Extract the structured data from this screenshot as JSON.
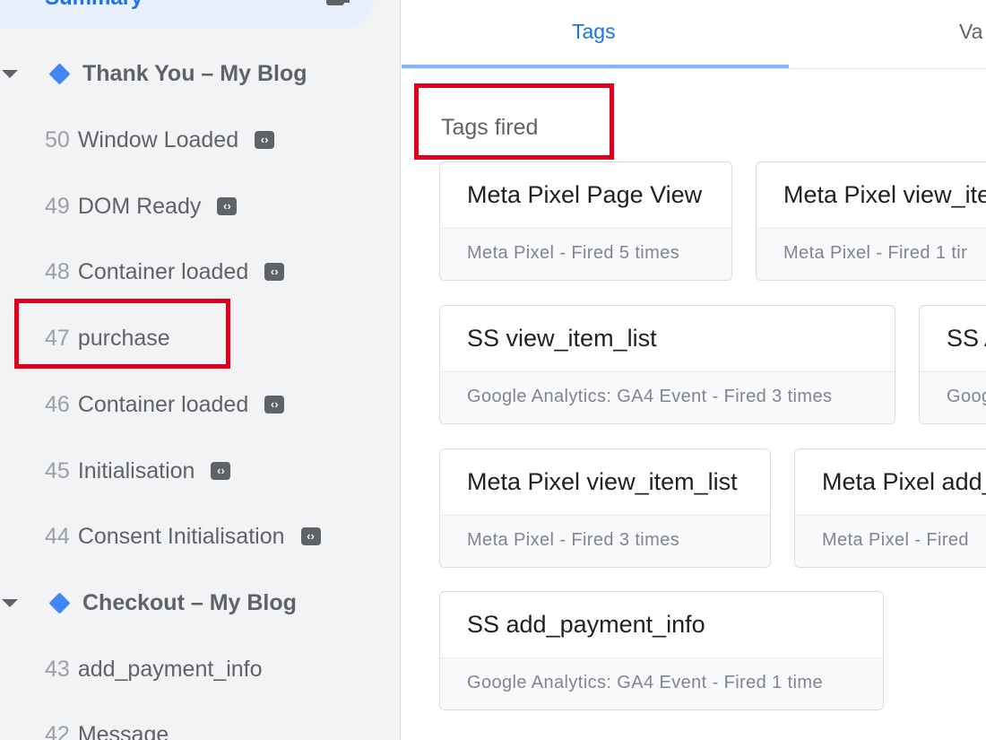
{
  "sidebar": {
    "summary_label": "Summary",
    "groups": [
      {
        "title": "Thank You – My Blog",
        "events": [
          {
            "num": "50",
            "name": "Window Loaded",
            "tag_icon": true
          },
          {
            "num": "49",
            "name": "DOM Ready",
            "tag_icon": true
          },
          {
            "num": "48",
            "name": "Container loaded",
            "tag_icon": true
          },
          {
            "num": "47",
            "name": "purchase",
            "tag_icon": false
          },
          {
            "num": "46",
            "name": "Container loaded",
            "tag_icon": true
          },
          {
            "num": "45",
            "name": "Initialisation",
            "tag_icon": true
          },
          {
            "num": "44",
            "name": "Consent Initialisation",
            "tag_icon": true
          }
        ]
      },
      {
        "title": "Checkout – My Blog",
        "events": [
          {
            "num": "43",
            "name": "add_payment_info",
            "tag_icon": false
          },
          {
            "num": "42",
            "name": "Message",
            "tag_icon": false
          }
        ]
      }
    ]
  },
  "main": {
    "tabs": [
      {
        "label": "Tags",
        "active": true
      },
      {
        "label": "Va",
        "active": false
      }
    ],
    "section_title": "Tags fired",
    "cards": [
      {
        "name": "Meta Pixel Page View",
        "info": "Meta Pixel - Fired 5 times"
      },
      {
        "name": "Meta Pixel view_ite",
        "info": "Meta Pixel - Fired 1 tir"
      },
      {
        "name": "SS view_item_list",
        "info": "Google Analytics: GA4 Event - Fired 3 times"
      },
      {
        "name": "SS A",
        "info": "Goog"
      },
      {
        "name": "Meta Pixel view_item_list",
        "info": "Meta Pixel - Fired 3 times"
      },
      {
        "name": "Meta Pixel add_",
        "info": "Meta Pixel - Fired"
      },
      {
        "name": "SS add_payment_info",
        "info": "Google Analytics: GA4 Event - Fired 1 time"
      }
    ]
  },
  "colors": {
    "accent": "#1a73e8",
    "highlight": "#e0001b",
    "diamond": "#4285f4"
  },
  "icons": {
    "tag": "code-tag-icon",
    "group": "diamond-icon",
    "collapse": "caret-down-icon"
  }
}
